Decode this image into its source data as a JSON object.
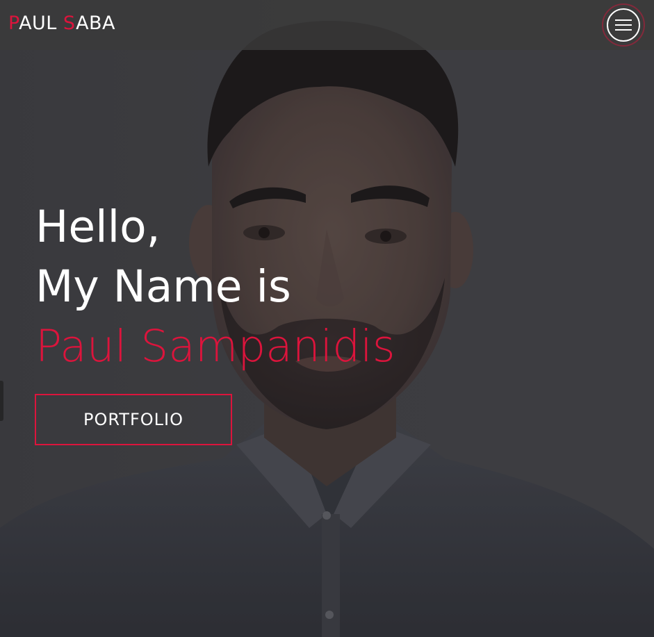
{
  "brand": {
    "first_initial": "P",
    "first_rest": "AUL ",
    "last_initial": "S",
    "last_rest": "ABA"
  },
  "nav": {
    "menu_icon": "hamburger-menu-icon"
  },
  "hero": {
    "line1": "Hello,",
    "line2": "My Name is",
    "name": "Paul Sampanidis",
    "cta_label": "PORTFOLIO",
    "background": "portrait photo of man in grey shirt"
  },
  "colors": {
    "accent": "#dc143c",
    "text": "#ffffff",
    "topbar": "#3a3a3a"
  }
}
